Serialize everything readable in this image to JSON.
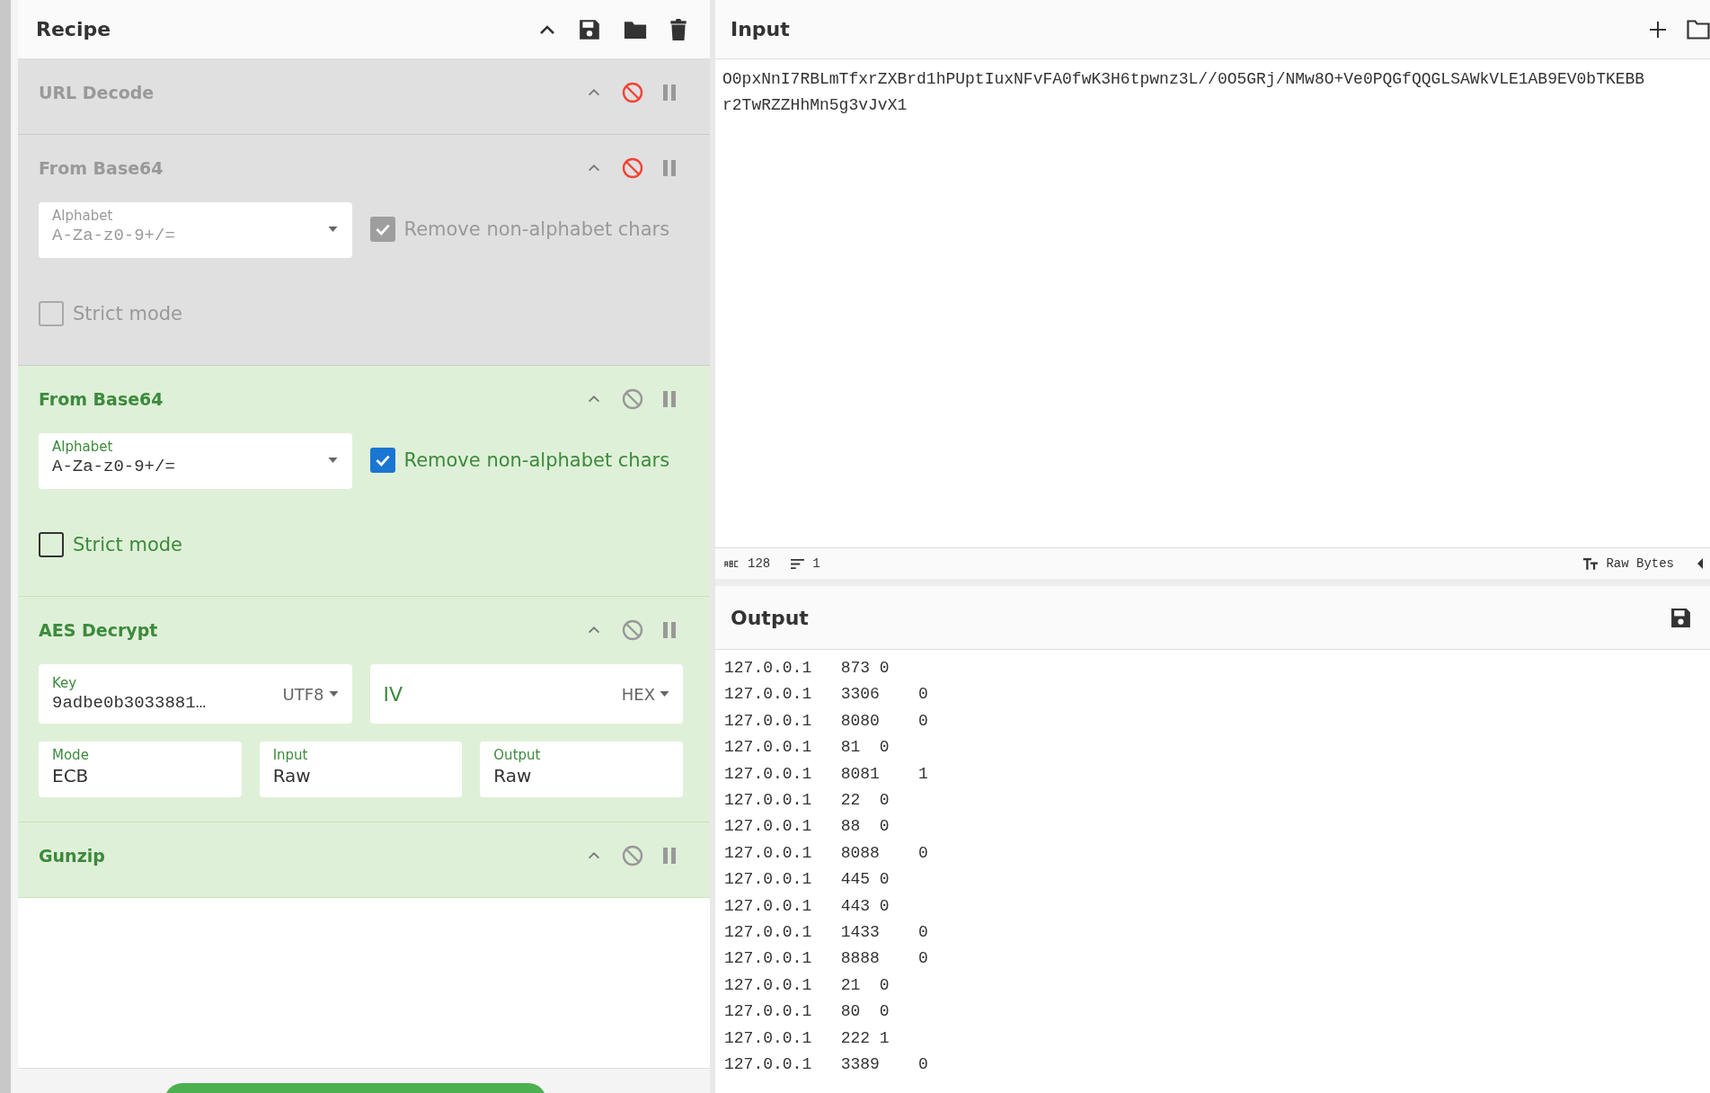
{
  "recipe": {
    "title": "Recipe",
    "operations": [
      {
        "name": "URL Decode",
        "disabled": true
      },
      {
        "name": "From Base64",
        "disabled": true,
        "args": [
          {
            "kind": "select",
            "label": "Alphabet",
            "value": "A-Za-z0-9+/="
          },
          {
            "kind": "checkbox",
            "label": "Remove non-alphabet chars",
            "checked": true
          },
          {
            "kind": "checkbox",
            "label": "Strict mode",
            "checked": false
          }
        ]
      },
      {
        "name": "From Base64",
        "disabled": false,
        "args": [
          {
            "kind": "select",
            "label": "Alphabet",
            "value": "A-Za-z0-9+/="
          },
          {
            "kind": "checkbox",
            "label": "Remove non-alphabet chars",
            "checked": true
          },
          {
            "kind": "checkbox",
            "label": "Strict mode",
            "checked": false
          }
        ]
      },
      {
        "name": "AES Decrypt",
        "disabled": false,
        "args": [
          {
            "kind": "toggle",
            "label": "Key",
            "value": "9adbe0b3033881…",
            "option": "UTF8"
          },
          {
            "kind": "toggle",
            "label": "IV",
            "option": "HEX"
          },
          {
            "kind": "dropdown",
            "label": "Mode",
            "value": "ECB"
          },
          {
            "kind": "dropdown",
            "label": "Input",
            "value": "Raw"
          },
          {
            "kind": "dropdown",
            "label": "Output",
            "value": "Raw"
          }
        ]
      },
      {
        "name": "Gunzip",
        "disabled": false
      }
    ]
  },
  "input": {
    "title": "Input",
    "lines": [
      "O0pxNnI7RBLmTfxrZXBrd1hPUptIuxNFvFA0fwK3H6tpwnz3L//0O5GRj/NMw8O+Ve0PQGfQQGLSAWkVLE1AB9EV0bTKEBB",
      "r2TwRZZHhMn5g3vJvX1"
    ]
  },
  "status_bar": {
    "length": "128",
    "lines": "1",
    "format": "Raw Bytes"
  },
  "output": {
    "title": "Output",
    "lines": [
      "127.0.0.1\t873\t0",
      "127.0.0.1\t3306\t0",
      "127.0.0.1\t8080\t0",
      "127.0.0.1\t81\t0",
      "127.0.0.1\t8081\t1",
      "127.0.0.1\t22\t0",
      "127.0.0.1\t88\t0",
      "127.0.0.1\t8088\t0",
      "127.0.0.1\t445\t0",
      "127.0.0.1\t443\t0",
      "127.0.0.1\t1433\t0",
      "127.0.0.1\t8888\t0",
      "127.0.0.1\t21\t0",
      "127.0.0.1\t80\t0",
      "127.0.0.1\t222\t1",
      "127.0.0.1\t3389\t0"
    ]
  }
}
